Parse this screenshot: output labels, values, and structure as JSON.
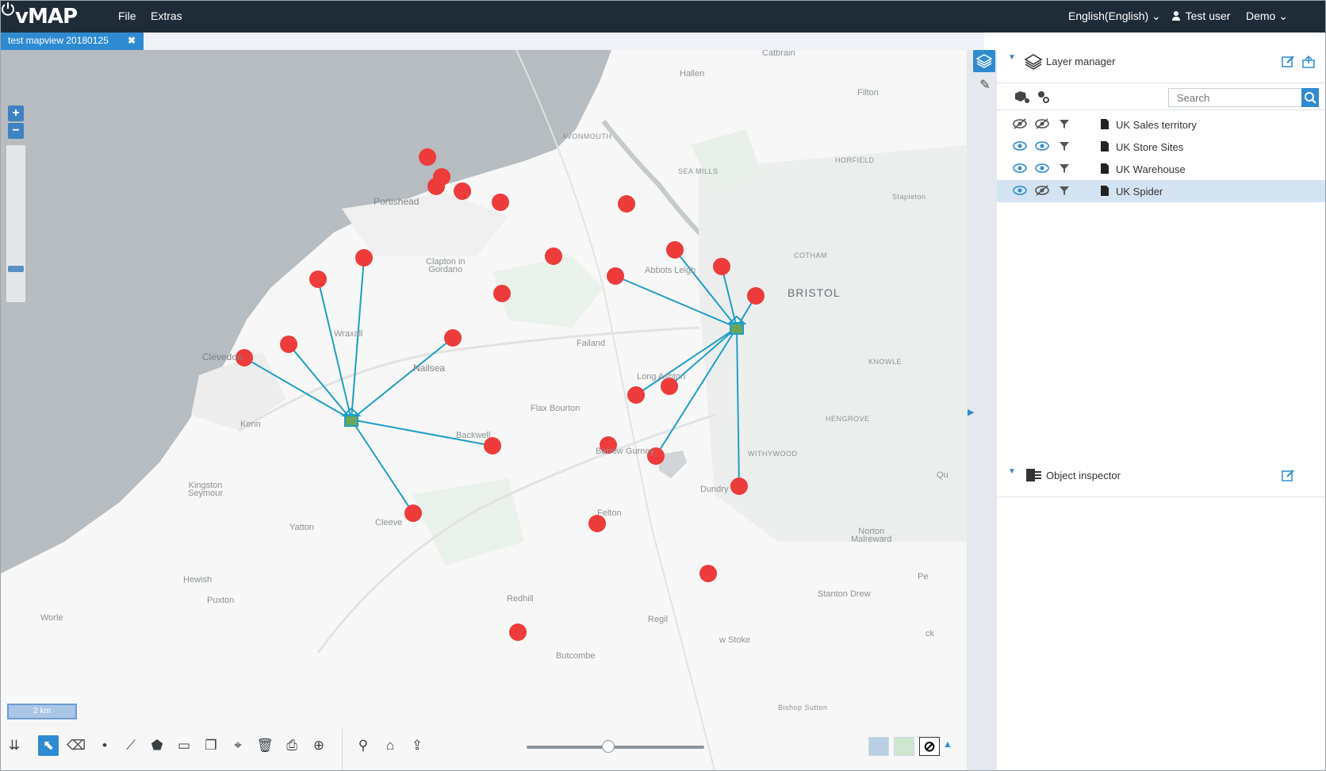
{
  "app": {
    "title": "vMAP"
  },
  "menu": {
    "file": "File",
    "extras": "Extras"
  },
  "topbar": {
    "language": "English(English) ⌄",
    "user": "Test user",
    "account": "Demo ⌄"
  },
  "tab": {
    "label": "test mapview 20180125",
    "close": "✖"
  },
  "zoom": {
    "in": "+",
    "out": "−"
  },
  "scale": {
    "label": "2 km"
  },
  "map": {
    "labels": [
      {
        "text": "Catbrain"
      },
      {
        "text": "Hallen"
      },
      {
        "text": "Filton"
      },
      {
        "text": "AVONMOUTH"
      },
      {
        "text": "SEA MILLS"
      },
      {
        "text": "HORFIELD"
      },
      {
        "text": "Portishead"
      },
      {
        "text": "Stapleton"
      },
      {
        "text": "Clapton in Gordano"
      },
      {
        "text": "COTHAM"
      },
      {
        "text": "Abbots Leigh"
      },
      {
        "text": "BRISTOL"
      },
      {
        "text": "Wraxall"
      },
      {
        "text": "Clevedon"
      },
      {
        "text": "Nailsea"
      },
      {
        "text": "Failand"
      },
      {
        "text": "KNOWLE"
      },
      {
        "text": "Long Ashton"
      },
      {
        "text": "Flax Bourton"
      },
      {
        "text": "Kenn"
      },
      {
        "text": "Backwell"
      },
      {
        "text": "HENGROVE"
      },
      {
        "text": "Barrow Gurney"
      },
      {
        "text": "WITHYWOOD"
      },
      {
        "text": "Kingston Seymour"
      },
      {
        "text": "Dundry"
      },
      {
        "text": "Qu"
      },
      {
        "text": "Cleeve"
      },
      {
        "text": "Felton"
      },
      {
        "text": "Yatton"
      },
      {
        "text": "Norton Malreward"
      },
      {
        "text": "Hewish"
      },
      {
        "text": "Pe"
      },
      {
        "text": "Stanton Drew"
      },
      {
        "text": "Puxton"
      },
      {
        "text": "Redhill"
      },
      {
        "text": "Worle"
      },
      {
        "text": "Regil"
      },
      {
        "text": "ck"
      },
      {
        "text": "Butcombe"
      },
      {
        "text": "w Stoke"
      },
      {
        "text": "Bishop Sutton"
      }
    ],
    "colors": {
      "store": "#ee3b3b",
      "spider": "#1f9ec8",
      "water": "#b6bcbf",
      "land": "#f6f7f6"
    }
  },
  "layer_manager": {
    "title": "Layer manager",
    "search_placeholder": "Search",
    "layers": [
      {
        "name": "UK Sales territory",
        "visible": false,
        "selected": false
      },
      {
        "name": "UK Store Sites",
        "visible": true,
        "selected": false
      },
      {
        "name": "UK Warehouse",
        "visible": true,
        "selected": false
      },
      {
        "name": "UK Spider",
        "visible": true,
        "selected": true
      }
    ]
  },
  "object_inspector": {
    "title": "Object inspector"
  },
  "toolbar": {
    "icons": [
      "collapse-icon",
      "select-icon",
      "eraser-icon",
      "point-icon",
      "line-icon",
      "polygon-icon",
      "measure-icon",
      "copy-icon",
      "map-pin-icon",
      "delete-icon",
      "print-icon",
      "zoom-extent-icon",
      "search-icon",
      "home-icon",
      "share-icon"
    ]
  }
}
